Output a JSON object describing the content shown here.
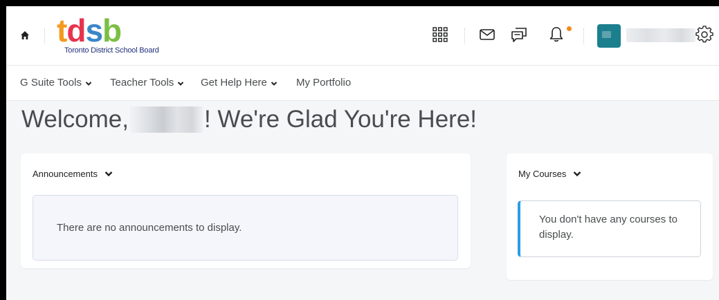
{
  "header": {
    "logo_text": "tdsb",
    "logo_subtitle": "Toronto District School Board",
    "icons": [
      "home-icon",
      "app-grid-icon",
      "mail-icon",
      "chat-icon",
      "bell-icon",
      "gear-icon"
    ],
    "notification_color": "#f08a1c",
    "avatar_color": "#1b7f8e"
  },
  "nav": {
    "items": [
      {
        "label": "G Suite Tools",
        "has_dropdown": true
      },
      {
        "label": "Teacher Tools",
        "has_dropdown": true
      },
      {
        "label": "Get Help Here",
        "has_dropdown": true
      },
      {
        "label": "My Portfolio",
        "has_dropdown": false
      }
    ]
  },
  "welcome": {
    "prefix": "Welcome,",
    "suffix": "! We're Glad You're Here!"
  },
  "announcements": {
    "title": "Announcements",
    "empty_message": "There are no announcements to display."
  },
  "courses": {
    "title": "My Courses",
    "empty_message": "You don't have any courses to display.",
    "accent_color": "#2a9ee6"
  }
}
